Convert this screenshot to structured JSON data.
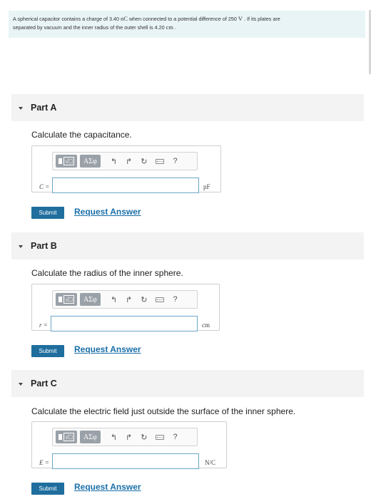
{
  "problem": {
    "line1_a": "A spherical capacitor contains a charge of 3.40 ",
    "line1_unit1": "nC",
    "line1_b": " when connected to a potential difference of 250 ",
    "line1_unit2": "V",
    "line1_c": " . If its plates are",
    "line2_a": "separated by vacuum and the inner radius of the outer shell is 4.20 ",
    "line2_unit": "cm",
    "line2_b": " ."
  },
  "toolbar": {
    "greek_label": "ΑΣφ",
    "help_label": "?"
  },
  "parts": [
    {
      "title": "Part A",
      "prompt": "Calculate the capacitance.",
      "variable": "C =",
      "value": "",
      "unit": "pF",
      "submit_label": "Submit",
      "request_label": "Request Answer"
    },
    {
      "title": "Part B",
      "prompt": "Calculate the radius of the inner sphere.",
      "variable": "r =",
      "value": "",
      "unit": "cm",
      "submit_label": "Submit",
      "request_label": "Request Answer"
    },
    {
      "title": "Part C",
      "prompt": "Calculate the electric field just outside the surface of the inner sphere.",
      "variable": "E =",
      "value": "",
      "unit": "N/C",
      "submit_label": "Submit",
      "request_label": "Request Answer"
    }
  ]
}
